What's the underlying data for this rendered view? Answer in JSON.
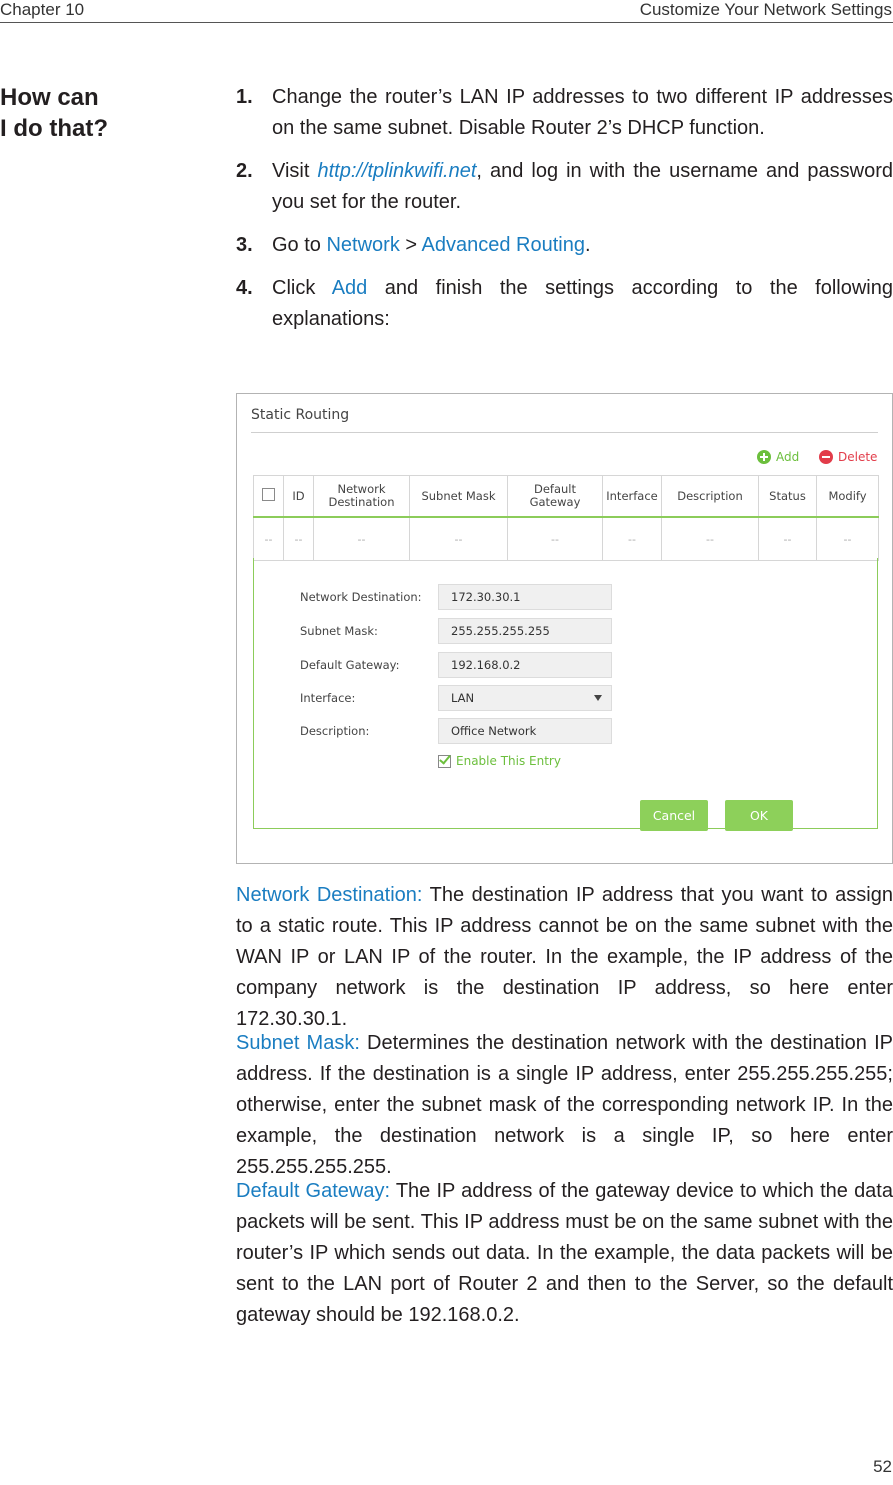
{
  "header": {
    "chapter": "Chapter 10",
    "section": "Customize Your Network Settings"
  },
  "side_heading": {
    "line1": "How can",
    "line2": "I do that?"
  },
  "steps": [
    {
      "num": "1.",
      "text": "Change the router’s LAN IP addresses to two different IP addresses on the same subnet. Disable Router 2’s DHCP function."
    },
    {
      "num": "2.",
      "pre": "Visit ",
      "link": "http://tplinkwifi.net",
      "post": ", and log in with the username and password you set for the router."
    },
    {
      "num": "3.",
      "pre": "Go to ",
      "link1": "Network",
      "sep": " > ",
      "link2": "Advanced Routing",
      "post": "."
    },
    {
      "num": "4.",
      "pre": "Click ",
      "link": "Add",
      "post": " and finish the settings according to the following explanations:"
    }
  ],
  "screenshot": {
    "title": "Static Routing",
    "toolbar": {
      "add_label": "Add",
      "delete_label": "Delete"
    },
    "table": {
      "columns": [
        "",
        "ID",
        "Network Destination",
        "Subnet Mask",
        "Default Gateway",
        "Interface",
        "Description",
        "Status",
        "Modify"
      ],
      "empty_row": [
        "--",
        "--",
        "--",
        "--",
        "--",
        "--",
        "--",
        "--",
        "--"
      ]
    },
    "form": {
      "fields": [
        {
          "label": "Network Destination:",
          "value": "172.30.30.1"
        },
        {
          "label": "Subnet Mask:",
          "value": "255.255.255.255"
        },
        {
          "label": "Default Gateway:",
          "value": "192.168.0.2"
        },
        {
          "label": "Interface:",
          "value": "LAN"
        },
        {
          "label": "Description:",
          "value": "Office Network"
        }
      ],
      "enable_label": "Enable This Entry",
      "enable_checked": true,
      "cancel_label": "Cancel",
      "ok_label": "OK"
    },
    "colors": {
      "accent_green": "#8dd05a",
      "delete_red": "#e23c4a",
      "link_blue": "#1a7dc1"
    }
  },
  "explanations": [
    {
      "term": "Network Destination:",
      "text": " The destination IP address that you want to assign to a static route. This IP address cannot be on the same subnet with the WAN IP or LAN IP of the router. In the example, the IP address of the company network is the destination IP address, so here enter 172.30.30.1."
    },
    {
      "term": "Subnet Mask:",
      "text": " Determines the destination network with the destination IP address. If the destination is a single IP address, enter 255.255.255.255; otherwise, enter the subnet mask of the corresponding network IP. In the example, the destination network is a single IP, so here enter 255.255.255.255."
    },
    {
      "term": "Default Gateway:",
      "text": " The IP address of the gateway device to which the data packets will be sent. This IP address must be on the same subnet with the router’s IP which sends out data. In the example, the data packets will be sent to the LAN port of Router 2 and then to the Server, so the default gateway should be 192.168.0.2."
    }
  ],
  "page_number": "52"
}
